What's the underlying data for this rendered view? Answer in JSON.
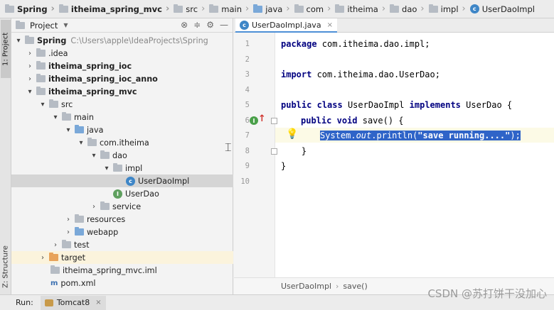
{
  "breadcrumb": [
    "Spring",
    "itheima_spring_mvc",
    "src",
    "main",
    "java",
    "com",
    "itheima",
    "dao",
    "impl",
    "UserDaoImpl"
  ],
  "left_strip": {
    "project_tab": "1: Project",
    "structure_tab": "Z: Structure"
  },
  "project_panel": {
    "title": "Project",
    "tree": [
      {
        "label": "Spring",
        "extra": "C:\\Users\\apple\\IdeaProjects\\Spring",
        "icon": "folder-icon"
      },
      {
        "label": ".idea",
        "icon": "folder-icon"
      },
      {
        "label": "itheima_spring_ioc",
        "icon": "module-folder-icon"
      },
      {
        "label": "itheima_spring_ioc_anno",
        "icon": "module-folder-icon"
      },
      {
        "label": "itheima_spring_mvc",
        "icon": "module-folder-icon"
      },
      {
        "label": "src",
        "icon": "folder-icon"
      },
      {
        "label": "main",
        "icon": "folder-icon"
      },
      {
        "label": "java",
        "icon": "source-folder-icon"
      },
      {
        "label": "com.itheima",
        "icon": "package-icon"
      },
      {
        "label": "dao",
        "icon": "package-icon"
      },
      {
        "label": "impl",
        "icon": "package-icon"
      },
      {
        "label": "UserDaoImpl",
        "icon": "class-icon"
      },
      {
        "label": "UserDao",
        "icon": "interface-icon"
      },
      {
        "label": "service",
        "icon": "package-icon"
      },
      {
        "label": "resources",
        "icon": "folder-icon"
      },
      {
        "label": "webapp",
        "icon": "folder-icon"
      },
      {
        "label": "test",
        "icon": "folder-icon"
      },
      {
        "label": "target",
        "icon": "excluded-folder-icon"
      },
      {
        "label": "itheima_spring_mvc.iml",
        "icon": "iml-file-icon"
      },
      {
        "label": "pom.xml",
        "icon": "maven-icon"
      }
    ]
  },
  "editor": {
    "tab_label": "UserDaoImpl.java",
    "line_numbers": [
      "1",
      "2",
      "3",
      "4",
      "5",
      "6",
      "7",
      "8",
      "9",
      "10"
    ],
    "lines": {
      "l1_kw": "package",
      "l1_rest": " com.itheima.dao.impl;",
      "l3_kw": "import",
      "l3_rest": " com.itheima.dao.UserDao;",
      "l5_kw1": "public",
      "l5_kw2": "class",
      "l5_name": " UserDaoImpl ",
      "l5_kw3": "implements",
      "l5_rest": " UserDao {",
      "l6_kw1": "public",
      "l6_kw2": "void",
      "l6_rest": " save() {",
      "l7_a": "System.",
      "l7_out": "out",
      "l7_b": ".println(",
      "l7_str": "\"save running....\"",
      "l7_c": ");",
      "l8": "    }",
      "l9": "}"
    },
    "breadcrumb": [
      "UserDaoImpl",
      "save()"
    ]
  },
  "run_bar": {
    "label": "Run:",
    "tab": "Tomcat8"
  },
  "watermark": "CSDN @苏打饼干没加心"
}
